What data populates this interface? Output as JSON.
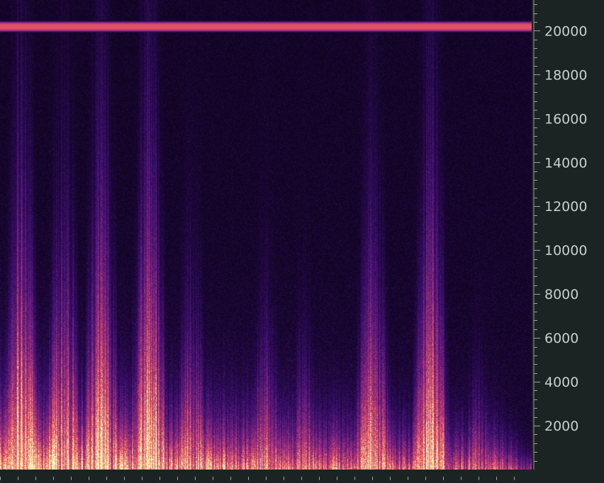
{
  "chart_data": {
    "type": "heatmap",
    "title": "",
    "xlabel": "",
    "ylabel": "",
    "y_axis_side": "right",
    "ylim": [
      0,
      21400
    ],
    "y_ticks": [
      2000,
      4000,
      6000,
      8000,
      10000,
      12000,
      14000,
      16000,
      18000,
      20000
    ],
    "y_tick_labels": [
      "2000",
      "4000",
      "6000",
      "8000",
      "10000",
      "12000",
      "14000",
      "16000",
      "18000",
      "20000"
    ],
    "y_minor_tick_step": 400,
    "x_range": [
      0,
      1
    ],
    "colormap": [
      "#000004",
      "#3b0f70",
      "#8c2981",
      "#de4968",
      "#fe9f6d",
      "#fcfdbf"
    ],
    "tone_band": {
      "frequency": 20200,
      "intensity": 0.62
    },
    "energy_bursts": [
      {
        "x": 0.04,
        "max_freq": 11000,
        "intensity": 1.0
      },
      {
        "x": 0.12,
        "max_freq": 9000,
        "intensity": 0.8
      },
      {
        "x": 0.19,
        "max_freq": 11000,
        "intensity": 0.95
      },
      {
        "x": 0.28,
        "max_freq": 12000,
        "intensity": 1.0
      },
      {
        "x": 0.36,
        "max_freq": 6000,
        "intensity": 0.6
      },
      {
        "x": 0.5,
        "max_freq": 5000,
        "intensity": 0.7
      },
      {
        "x": 0.57,
        "max_freq": 4000,
        "intensity": 0.6
      },
      {
        "x": 0.7,
        "max_freq": 9000,
        "intensity": 0.85
      },
      {
        "x": 0.81,
        "max_freq": 11000,
        "intensity": 0.9
      },
      {
        "x": 0.9,
        "max_freq": 3000,
        "intensity": 0.45
      }
    ]
  }
}
